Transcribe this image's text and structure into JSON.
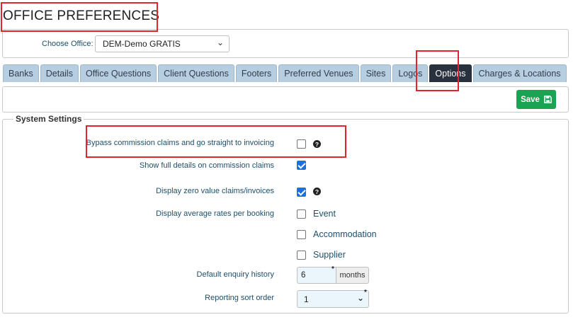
{
  "page": {
    "title": "OFFICE PREFERENCES"
  },
  "office": {
    "label": "Choose Office:",
    "selected": "DEM-Demo GRATIS"
  },
  "tabs": [
    {
      "label": "Banks",
      "active": false
    },
    {
      "label": "Details",
      "active": false
    },
    {
      "label": "Office Questions",
      "active": false
    },
    {
      "label": "Client Questions",
      "active": false
    },
    {
      "label": "Footers",
      "active": false
    },
    {
      "label": "Preferred Venues",
      "active": false
    },
    {
      "label": "Sites",
      "active": false
    },
    {
      "label": "Logos",
      "active": false
    },
    {
      "label": "Options",
      "active": true
    },
    {
      "label": "Charges & Locations",
      "active": false
    }
  ],
  "toolbar": {
    "save_label": "Save"
  },
  "system_settings": {
    "legend": "System Settings",
    "bypass_commission": {
      "label": "Bypass commission claims and go straight to invoicing",
      "checked": false
    },
    "show_full_details": {
      "label": "Show full details on commission claims",
      "checked": true
    },
    "display_zero_value": {
      "label": "Display zero value claims/invoices",
      "checked": true
    },
    "display_average_rates": {
      "label": "Display average rates per booking",
      "options": [
        {
          "label": "Event",
          "checked": false
        },
        {
          "label": "Accommodation",
          "checked": false
        },
        {
          "label": "Supplier",
          "checked": false
        }
      ]
    },
    "default_enquiry_history": {
      "label": "Default enquiry history",
      "value": "6",
      "unit": "months"
    },
    "reporting_sort_order": {
      "label": "Reporting sort order",
      "value": "1"
    }
  },
  "colors": {
    "active_tab": "#29313d",
    "tab": "#b7cde0",
    "save_button": "#1aa352",
    "highlight": "#e0262b",
    "checkbox_checked": "#1f6fdd"
  }
}
